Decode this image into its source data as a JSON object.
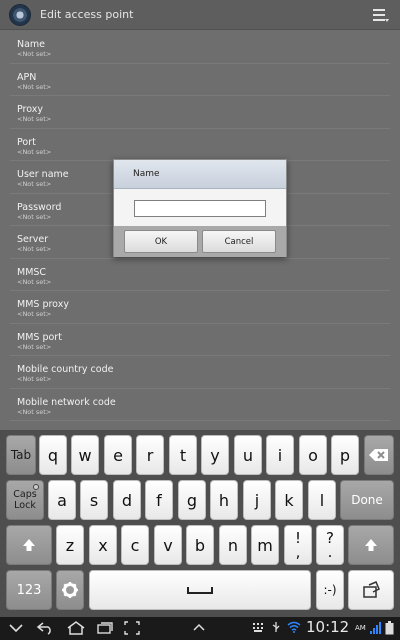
{
  "header": {
    "title": "Edit access point"
  },
  "settings": [
    {
      "label": "Name",
      "value": "<Not set>"
    },
    {
      "label": "APN",
      "value": "<Not set>"
    },
    {
      "label": "Proxy",
      "value": "<Not set>"
    },
    {
      "label": "Port",
      "value": "<Not set>"
    },
    {
      "label": "User name",
      "value": "<Not set>"
    },
    {
      "label": "Password",
      "value": "<Not set>"
    },
    {
      "label": "Server",
      "value": "<Not set>"
    },
    {
      "label": "MMSC",
      "value": "<Not set>"
    },
    {
      "label": "MMS proxy",
      "value": "<Not set>"
    },
    {
      "label": "MMS port",
      "value": "<Not set>"
    },
    {
      "label": "Mobile country code",
      "value": "<Not set>"
    },
    {
      "label": "Mobile network code",
      "value": "<Not set>"
    }
  ],
  "dialog": {
    "title": "Name",
    "input_value": "",
    "ok_label": "OK",
    "cancel_label": "Cancel"
  },
  "keyboard": {
    "row1": [
      "Tab",
      "q",
      "w",
      "e",
      "r",
      "t",
      "y",
      "u",
      "i",
      "o",
      "p"
    ],
    "row2": [
      "Caps",
      "Lock",
      "a",
      "s",
      "d",
      "f",
      "g",
      "h",
      "j",
      "k",
      "l",
      "Done"
    ],
    "row3": [
      "z",
      "x",
      "c",
      "v",
      "b",
      "n",
      "m",
      "!",
      ",",
      "?",
      "."
    ],
    "row4": [
      "123",
      ":-)"
    ]
  },
  "status": {
    "time": "10:12",
    "ampm": "AM"
  },
  "colors": {
    "accent": "#2e86ff",
    "dialog_title": "#c8d0dc",
    "keyboard_bg": "#4e4e4e"
  }
}
